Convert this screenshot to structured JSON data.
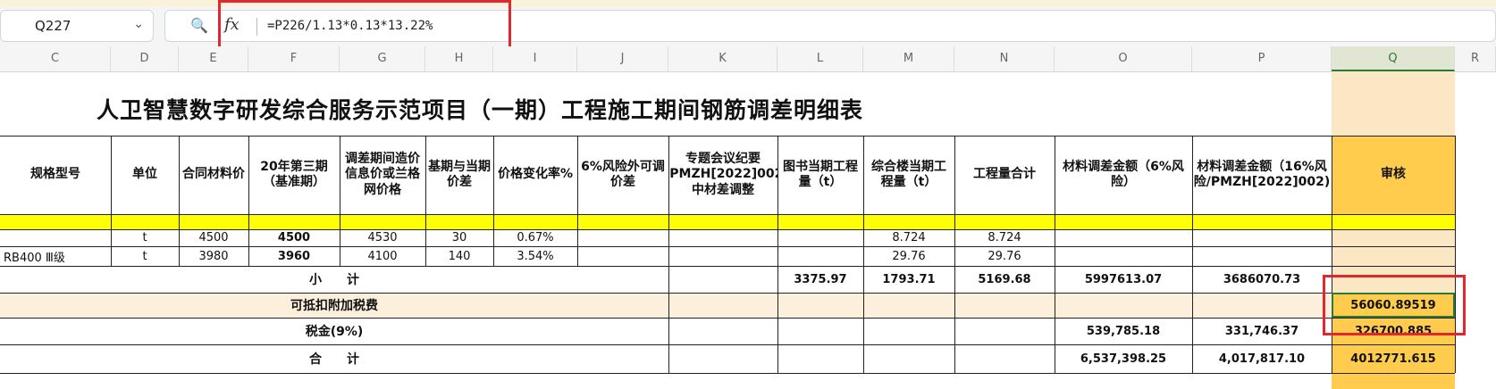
{
  "formula_bar": {
    "cell_ref": "Q227",
    "formula": "=P226/1.13*0.13*13.22%",
    "zoom_icon": "🔍",
    "chevron_icon": "⌄"
  },
  "column_headers": [
    "C",
    "D",
    "E",
    "F",
    "G",
    "H",
    "I",
    "J",
    "K",
    "L",
    "M",
    "N",
    "O",
    "P",
    "Q",
    "R"
  ],
  "title": "人卫智慧数字研发综合服务示范项目（一期）工程施工期间钢筋调差明细表",
  "header_row": {
    "spec": "规格型号",
    "unit": "单位",
    "contract_price": "合同材料价",
    "base_period": "20年第三期（基准期）",
    "adjust_price": "调差期间造价信息价或兰格网价格",
    "price_diff": "基期与当期价差",
    "change_rate": "价格变化率%",
    "risk_diff": "6%风险外可调价差",
    "meeting": "专题会议纪要（PMZH[2022]002)中材差调整",
    "lib_qty": "图书当期工程量（t）",
    "complex_qty": "综合楼当期工程量（t）",
    "qty_total": "工程量合计",
    "amount6": "材料调差金额（6%风险）",
    "amount16": "材料调差金额（16%风险/PMZH[2022]002)",
    "audit": "审核"
  },
  "rows": [
    {
      "spec": "",
      "unit": "t",
      "contract": "4500",
      "base": "4500",
      "adjust": "4530",
      "diff": "30",
      "rate": "0.67%",
      "lib": "",
      "complex": "8.724",
      "total": "8.724"
    },
    {
      "spec": "RB400 Ⅲ级",
      "unit": "t",
      "contract": "3980",
      "base": "3960",
      "adjust": "4100",
      "diff": "140",
      "rate": "3.54%",
      "lib": "",
      "complex": "29.76",
      "total": "29.76"
    }
  ],
  "subtotal": {
    "label": "小　　计",
    "lib": "3375.97",
    "complex": "1793.71",
    "total": "5169.68",
    "amount6": "5997613.07",
    "amount16": "3686070.73"
  },
  "deductible": {
    "label": "可抵扣附加税费",
    "audit": "56060.89519"
  },
  "tax": {
    "label": "税金(9%)",
    "amount6": "539,785.18",
    "amount16": "331,746.37",
    "audit": "326700.885"
  },
  "grand_total": {
    "label": "合　　计",
    "amount6": "6,537,398.25",
    "amount16": "4,017,817.10",
    "audit": "4012771.615"
  },
  "colors": {
    "yellow_row": "#ffff00",
    "audit_col": "#fce7c4",
    "audit_bold": "#ffcc4d",
    "deductible_row": "#fcefdc",
    "highlight_red": "#e0282e",
    "selected_green": "#2d7a38"
  }
}
